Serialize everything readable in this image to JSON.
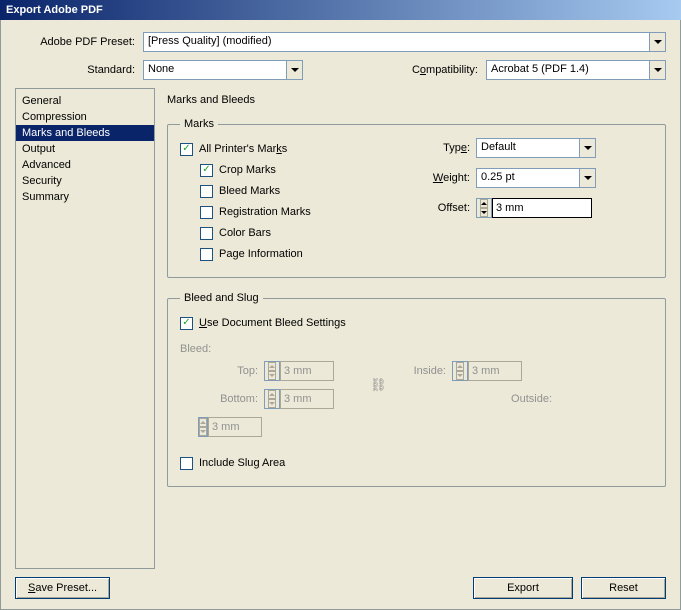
{
  "title": "Export Adobe PDF",
  "header": {
    "preset_label": "Adobe PDF Preset:",
    "preset_value": "[Press Quality] (modified)",
    "standard_label": "Standard:",
    "standard_value": "None",
    "compat_label_pre": "C",
    "compat_label_under": "o",
    "compat_label_post": "mpatibility:",
    "compat_value": "Acrobat 5 (PDF 1.4)"
  },
  "sidebar": {
    "items": [
      {
        "label": "General"
      },
      {
        "label": "Compression"
      },
      {
        "label": "Marks and Bleeds"
      },
      {
        "label": "Output"
      },
      {
        "label": "Advanced"
      },
      {
        "label": "Security"
      },
      {
        "label": "Summary"
      }
    ],
    "selected_index": 2
  },
  "panel": {
    "title": "Marks and Bleeds",
    "marks": {
      "legend": "Marks",
      "all_pre": "All Printer's Mar",
      "all_under": "k",
      "all_post": "s",
      "all_checked": true,
      "crop": "Crop Marks",
      "crop_checked": true,
      "bleed": "Bleed Marks",
      "bleed_checked": false,
      "reg": "Registration Marks",
      "reg_checked": false,
      "color": "Color Bars",
      "color_checked": false,
      "page": "Page Information",
      "page_checked": false,
      "type_lab_pre": "Typ",
      "type_lab_under": "e",
      "type_lab_post": ":",
      "type_value": "Default",
      "weight_lab_under": "W",
      "weight_lab_post": "eight:",
      "weight_value": "0.25 pt",
      "offset_lab": "Offset:",
      "offset_value": "3 mm"
    },
    "bleedslug": {
      "legend": "Bleed and Slug",
      "use_doc_under": "U",
      "use_doc_post": "se Document Bleed Settings",
      "use_doc_checked": true,
      "bleed_label": "Bleed:",
      "top_lab": "Top:",
      "bottom_lab": "Bottom:",
      "inside_lab": "Inside:",
      "outside_lab": "Outside:",
      "val_top": "3 mm",
      "val_bottom": "3 mm",
      "val_inside": "3 mm",
      "val_outside": "3 mm",
      "slug_pre": "Include Slu",
      "slug_under": "g",
      "slug_post": " Area",
      "slug_checked": false
    }
  },
  "footer": {
    "save_preset": "Save Preset...",
    "export": "Export",
    "reset": "Reset"
  }
}
